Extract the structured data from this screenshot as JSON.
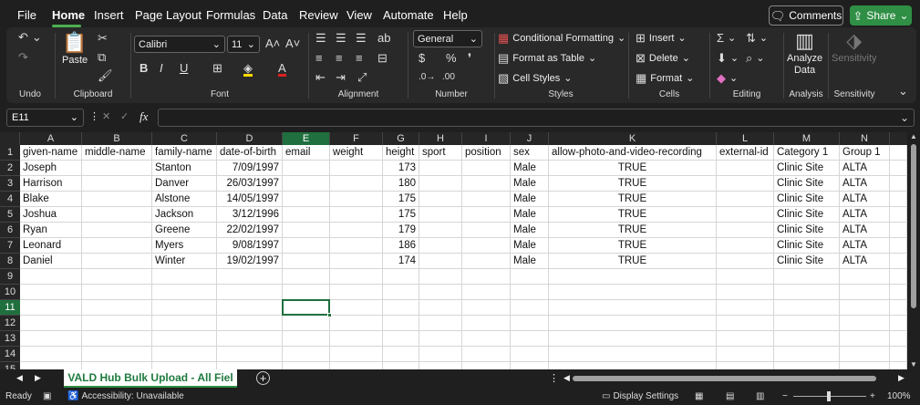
{
  "menu": {
    "items": [
      "File",
      "Home",
      "Insert",
      "Page Layout",
      "Formulas",
      "Data",
      "Review",
      "View",
      "Automate",
      "Help"
    ],
    "comments": "Comments",
    "share": "Share"
  },
  "ribbon": {
    "undo_label": "Undo",
    "clipboard": {
      "label": "Clipboard",
      "paste": "Paste"
    },
    "font": {
      "label": "Font",
      "family": "Calibri",
      "size": "11"
    },
    "alignment": {
      "label": "Alignment"
    },
    "number": {
      "label": "Number",
      "format": "General"
    },
    "styles": {
      "label": "Styles",
      "conditional": "Conditional Formatting",
      "format_table": "Format as Table",
      "cell_styles": "Cell Styles"
    },
    "cells": {
      "label": "Cells",
      "insert": "Insert",
      "delete": "Delete",
      "format": "Format"
    },
    "editing": {
      "label": "Editing"
    },
    "analysis": {
      "label": "Analysis",
      "analyze": "Analyze",
      "analyze2": "Data"
    },
    "sensitivity": {
      "label": "Sensitivity",
      "btn": "Sensitivity"
    }
  },
  "formula_bar": {
    "name_box": "E11",
    "fx": "fx",
    "content": ""
  },
  "columns": [
    "A",
    "B",
    "C",
    "D",
    "E",
    "F",
    "G",
    "H",
    "I",
    "J",
    "K",
    "L",
    "M",
    "N"
  ],
  "rows": [
    "1",
    "2",
    "3",
    "4",
    "5",
    "6",
    "7",
    "8",
    "9",
    "10",
    "11",
    "12",
    "13",
    "14",
    "15"
  ],
  "table": {
    "headers": [
      "given-name",
      "middle-name",
      "family-name",
      "date-of-birth",
      "email",
      "weight",
      "height",
      "sport",
      "position",
      "sex",
      "allow-photo-and-video-recording",
      "external-id",
      "Category 1",
      "Group 1"
    ],
    "data": [
      [
        "Joseph",
        "",
        "Stanton",
        "7/09/1997",
        "",
        "",
        "173",
        "",
        "",
        "Male",
        "TRUE",
        "",
        "Clinic Site",
        "ALTA"
      ],
      [
        "Harrison",
        "",
        "Danver",
        "26/03/1997",
        "",
        "",
        "180",
        "",
        "",
        "Male",
        "TRUE",
        "",
        "Clinic Site",
        "ALTA"
      ],
      [
        "Blake",
        "",
        "Alstone",
        "14/05/1997",
        "",
        "",
        "175",
        "",
        "",
        "Male",
        "TRUE",
        "",
        "Clinic Site",
        "ALTA"
      ],
      [
        "Joshua",
        "",
        "Jackson",
        "3/12/1996",
        "",
        "",
        "175",
        "",
        "",
        "Male",
        "TRUE",
        "",
        "Clinic Site",
        "ALTA"
      ],
      [
        "Ryan",
        "",
        "Greene",
        "22/02/1997",
        "",
        "",
        "179",
        "",
        "",
        "Male",
        "TRUE",
        "",
        "Clinic Site",
        "ALTA"
      ],
      [
        "Leonard",
        "",
        "Myers",
        "9/08/1997",
        "",
        "",
        "186",
        "",
        "",
        "Male",
        "TRUE",
        "",
        "Clinic Site",
        "ALTA"
      ],
      [
        "Daniel",
        "",
        "Winter",
        "19/02/1997",
        "",
        "",
        "174",
        "",
        "",
        "Male",
        "TRUE",
        "",
        "Clinic Site",
        "ALTA"
      ]
    ]
  },
  "sheet_tab": "VALD Hub Bulk Upload - All Fiel",
  "status": {
    "ready": "Ready",
    "accessibility": "Accessibility: Unavailable",
    "display": "Display Settings",
    "zoom": "100%"
  },
  "colors": {
    "accent": "#2f8f45",
    "selected": "#1f6f3f"
  }
}
